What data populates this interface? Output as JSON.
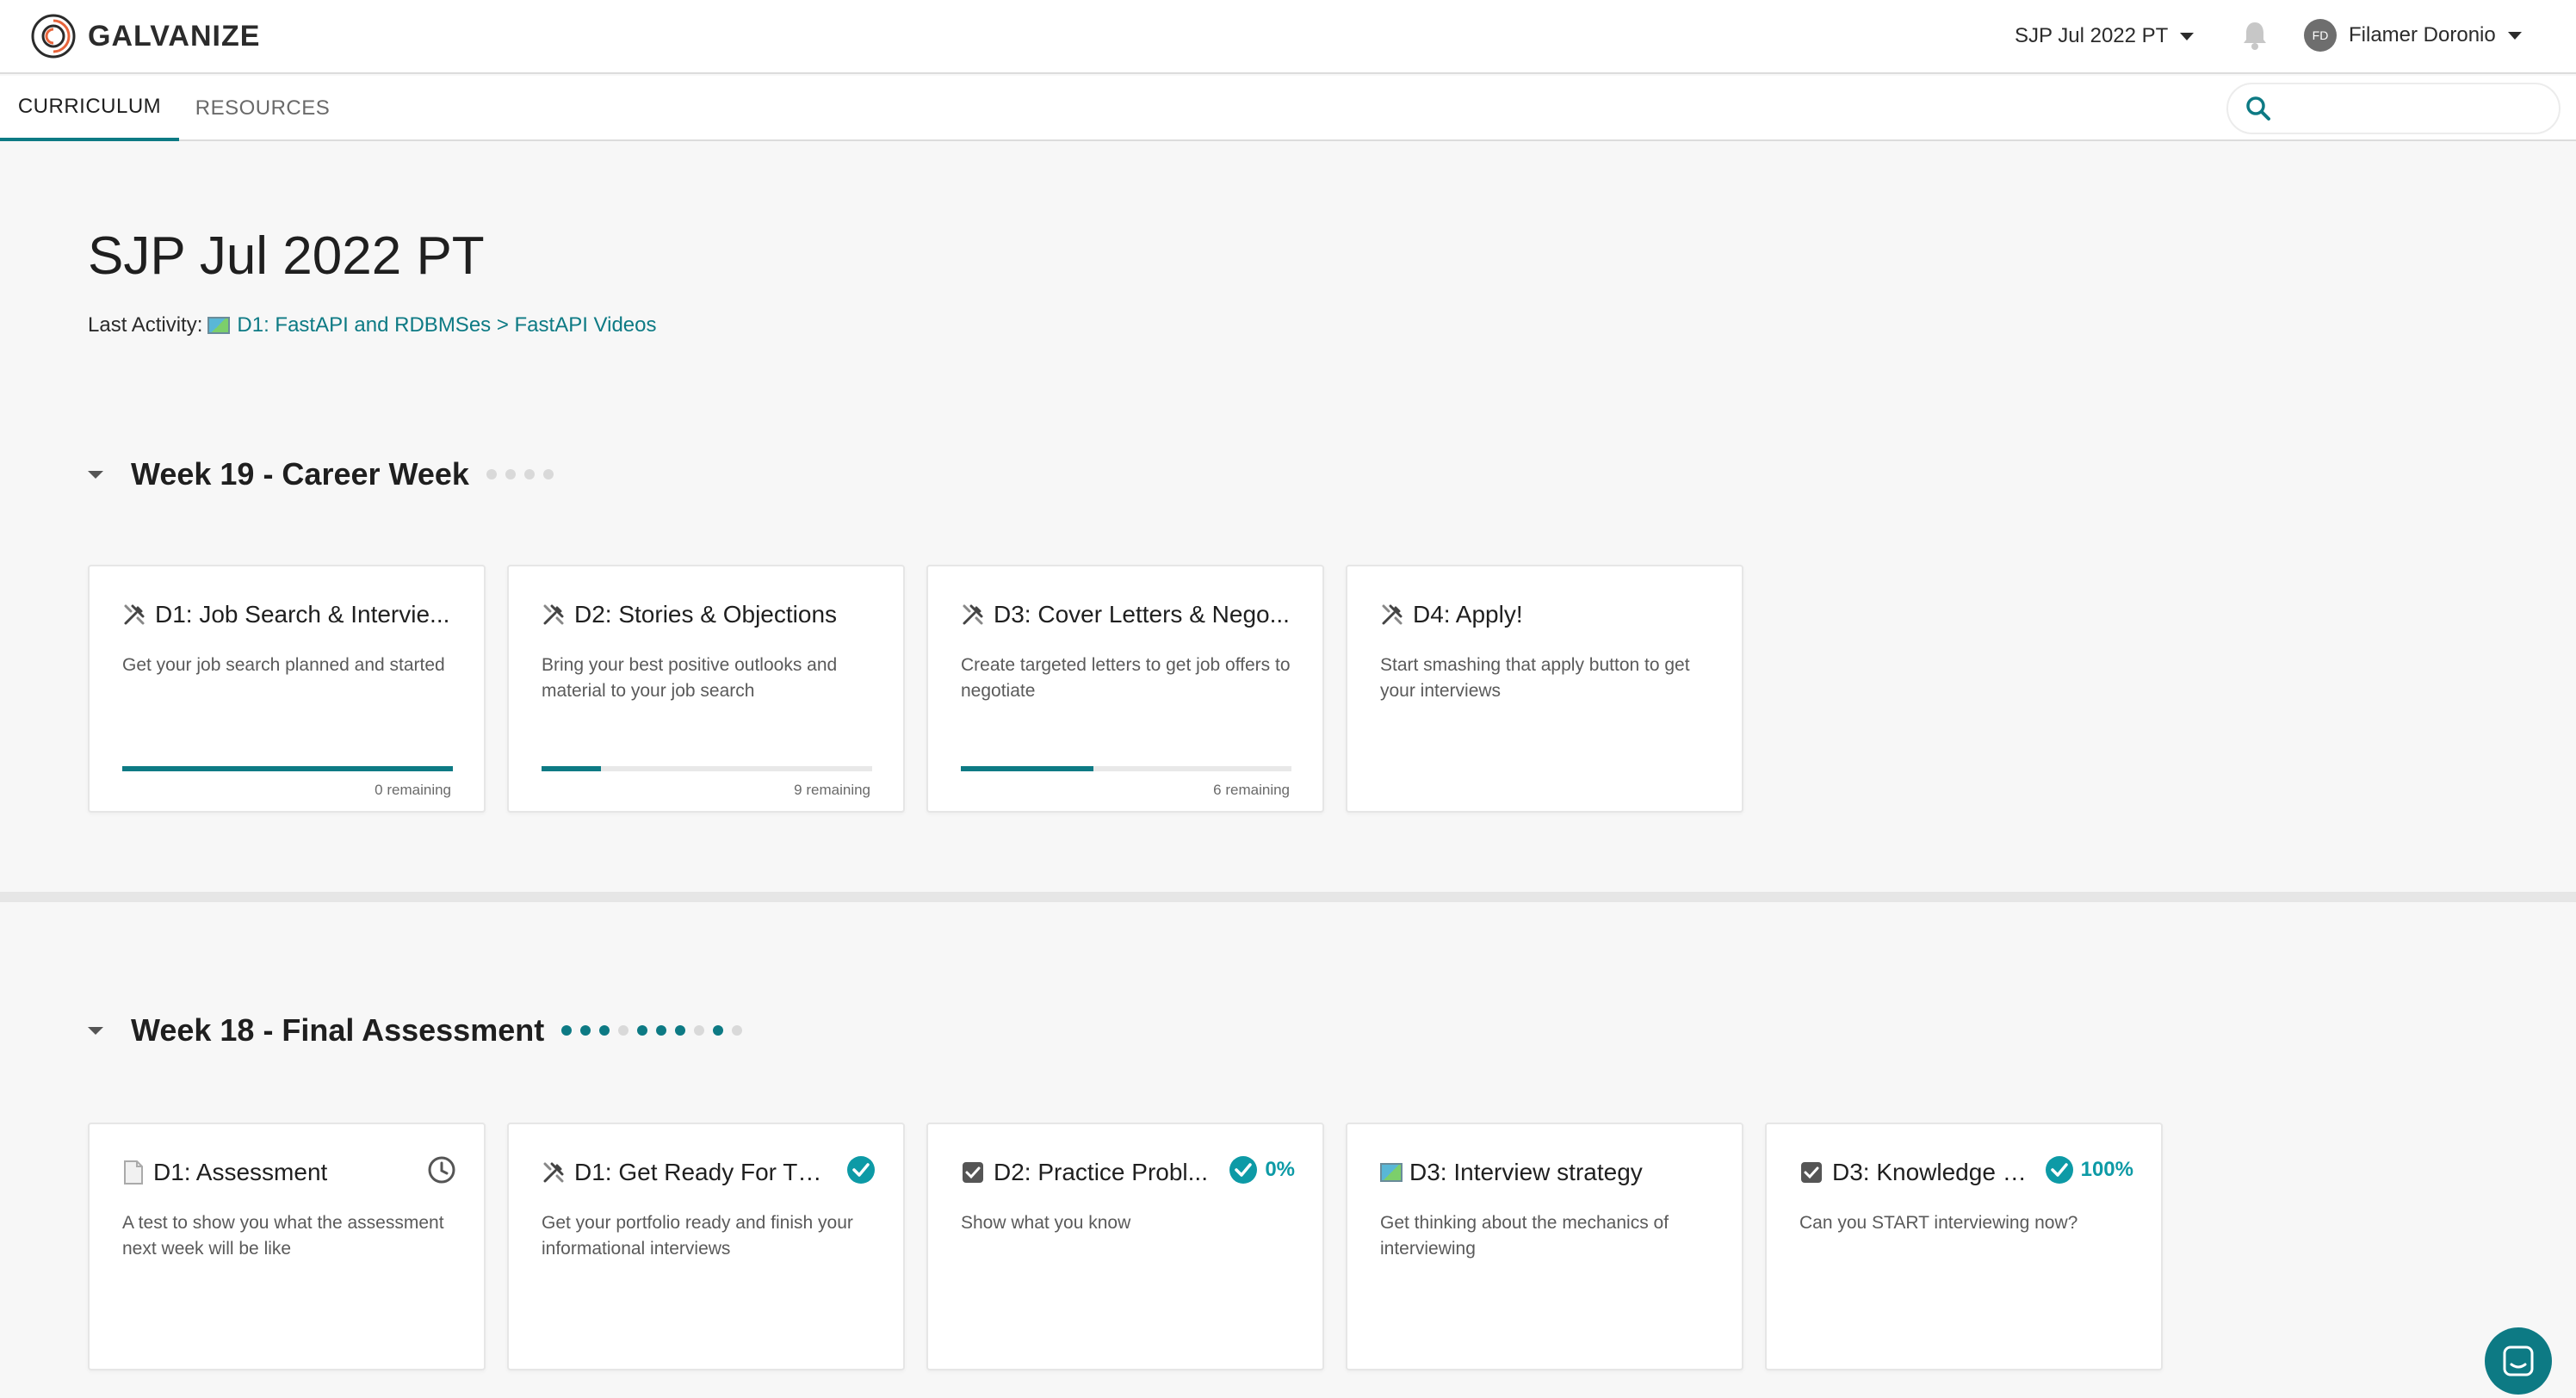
{
  "brand": {
    "name": "GALVANIZE",
    "accent": "#0d7a84"
  },
  "header": {
    "cohort": "SJP Jul 2022 PT",
    "user_initials": "FD",
    "user_name": "Filamer Doronio"
  },
  "nav": {
    "tabs": [
      "CURRICULUM",
      "RESOURCES"
    ],
    "search_placeholder": ""
  },
  "page": {
    "title": "SJP Jul 2022 PT",
    "last_activity_label": "Last Activity:",
    "last_activity_link": "D1: FastAPI and RDBMSes > FastAPI Videos"
  },
  "weeks": [
    {
      "title": "Week 19 - Career Week",
      "dots_completed": [
        false,
        false,
        false,
        false
      ],
      "cards": [
        {
          "icon": "tools-icon",
          "title": "D1: Job Search & Intervie...",
          "desc": "Get your job search planned and started",
          "progress": 1.0,
          "remaining": "0 remaining"
        },
        {
          "icon": "tools-icon",
          "title": "D2: Stories & Objections",
          "desc": "Bring your best positive outlooks and material to your job search",
          "progress": 0.18,
          "remaining": "9 remaining"
        },
        {
          "icon": "tools-icon",
          "title": "D3: Cover Letters & Nego...",
          "desc": "Create targeted letters to get job offers to negotiate",
          "progress": 0.4,
          "remaining": "6 remaining"
        },
        {
          "icon": "tools-icon",
          "title": "D4: Apply!",
          "desc": "Start smashing that apply button to get your interviews"
        }
      ]
    },
    {
      "title": "Week 18 - Final Assessment",
      "dots_completed": [
        true,
        true,
        true,
        false,
        true,
        true,
        true,
        false,
        true,
        false
      ],
      "cards": [
        {
          "icon": "document-icon",
          "title": "D1: Assessment",
          "desc": "A test to show you what the assessment next week will be like",
          "status_icon": "clock-icon"
        },
        {
          "icon": "tools-icon",
          "title": "D1: Get Ready For Th...",
          "desc": "Get your portfolio ready and finish your informational interviews",
          "status_icon": "check-circle-icon"
        },
        {
          "icon": "checkbox-icon",
          "title": "D2: Practice Probl...",
          "desc": "Show what you know",
          "status_icon": "check-circle-icon",
          "percent": "0%"
        },
        {
          "icon": "map-icon",
          "title": "D3: Interview strategy",
          "desc": "Get thinking about the mechanics of interviewing"
        },
        {
          "icon": "checkbox-icon",
          "title": "D3: Knowledge C...",
          "desc": "Can you START interviewing now?",
          "status_icon": "check-circle-icon",
          "percent": "100%"
        }
      ]
    }
  ]
}
